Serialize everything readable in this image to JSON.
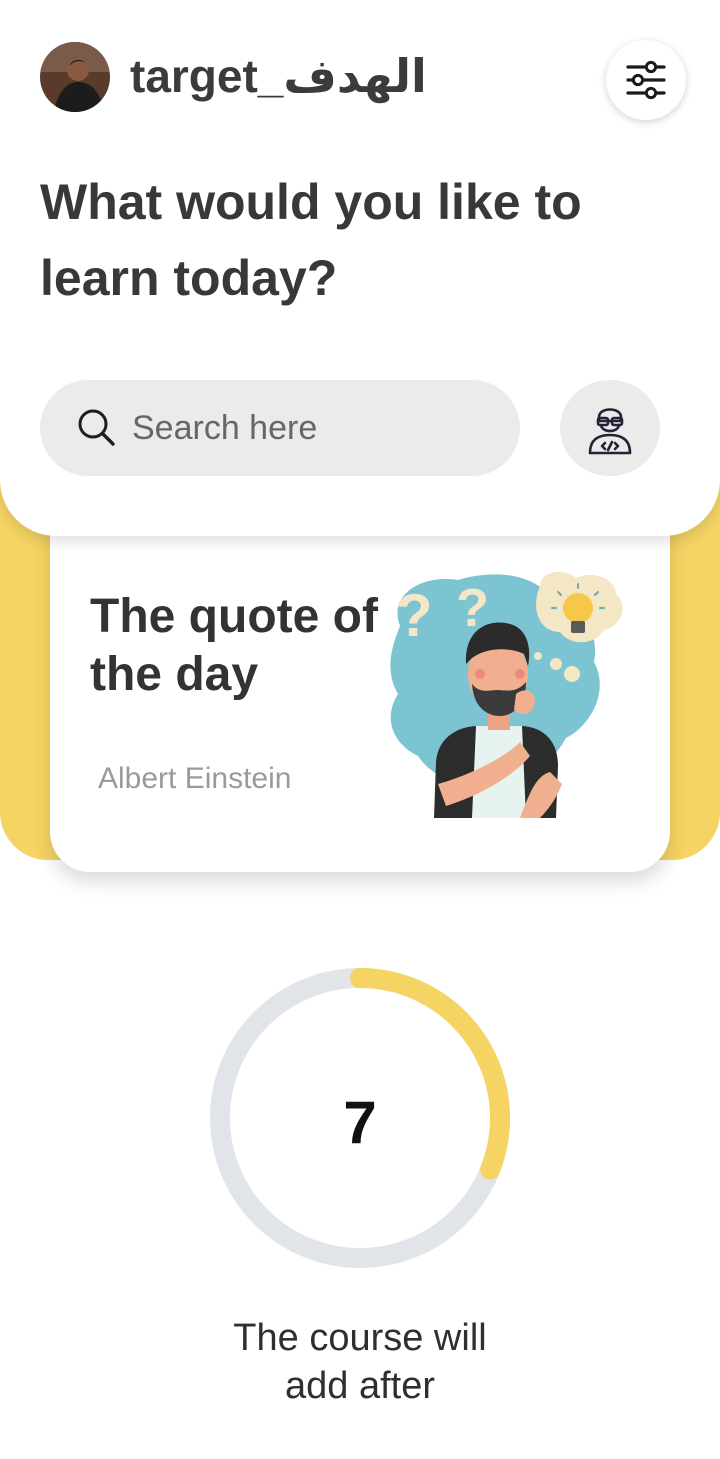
{
  "header": {
    "username": "target_الهدف",
    "headline": "What would you like to learn today?"
  },
  "search": {
    "placeholder": "Search here",
    "value": ""
  },
  "quote": {
    "title": "The quote of the day",
    "author": "Albert Einstein"
  },
  "course_timer": {
    "value": "7",
    "progress_fraction": 0.31,
    "caption_line1": "The course will",
    "caption_line2": "add after"
  },
  "colors": {
    "accent_yellow": "#F5D463",
    "ring_track": "#E1E4E8",
    "search_bg": "#ECEBE9",
    "text_dark": "#333333",
    "text_muted": "#9A9A9A"
  },
  "icons": {
    "filter": "sliders-icon",
    "search": "search-icon",
    "profile": "developer-avatar-icon"
  }
}
